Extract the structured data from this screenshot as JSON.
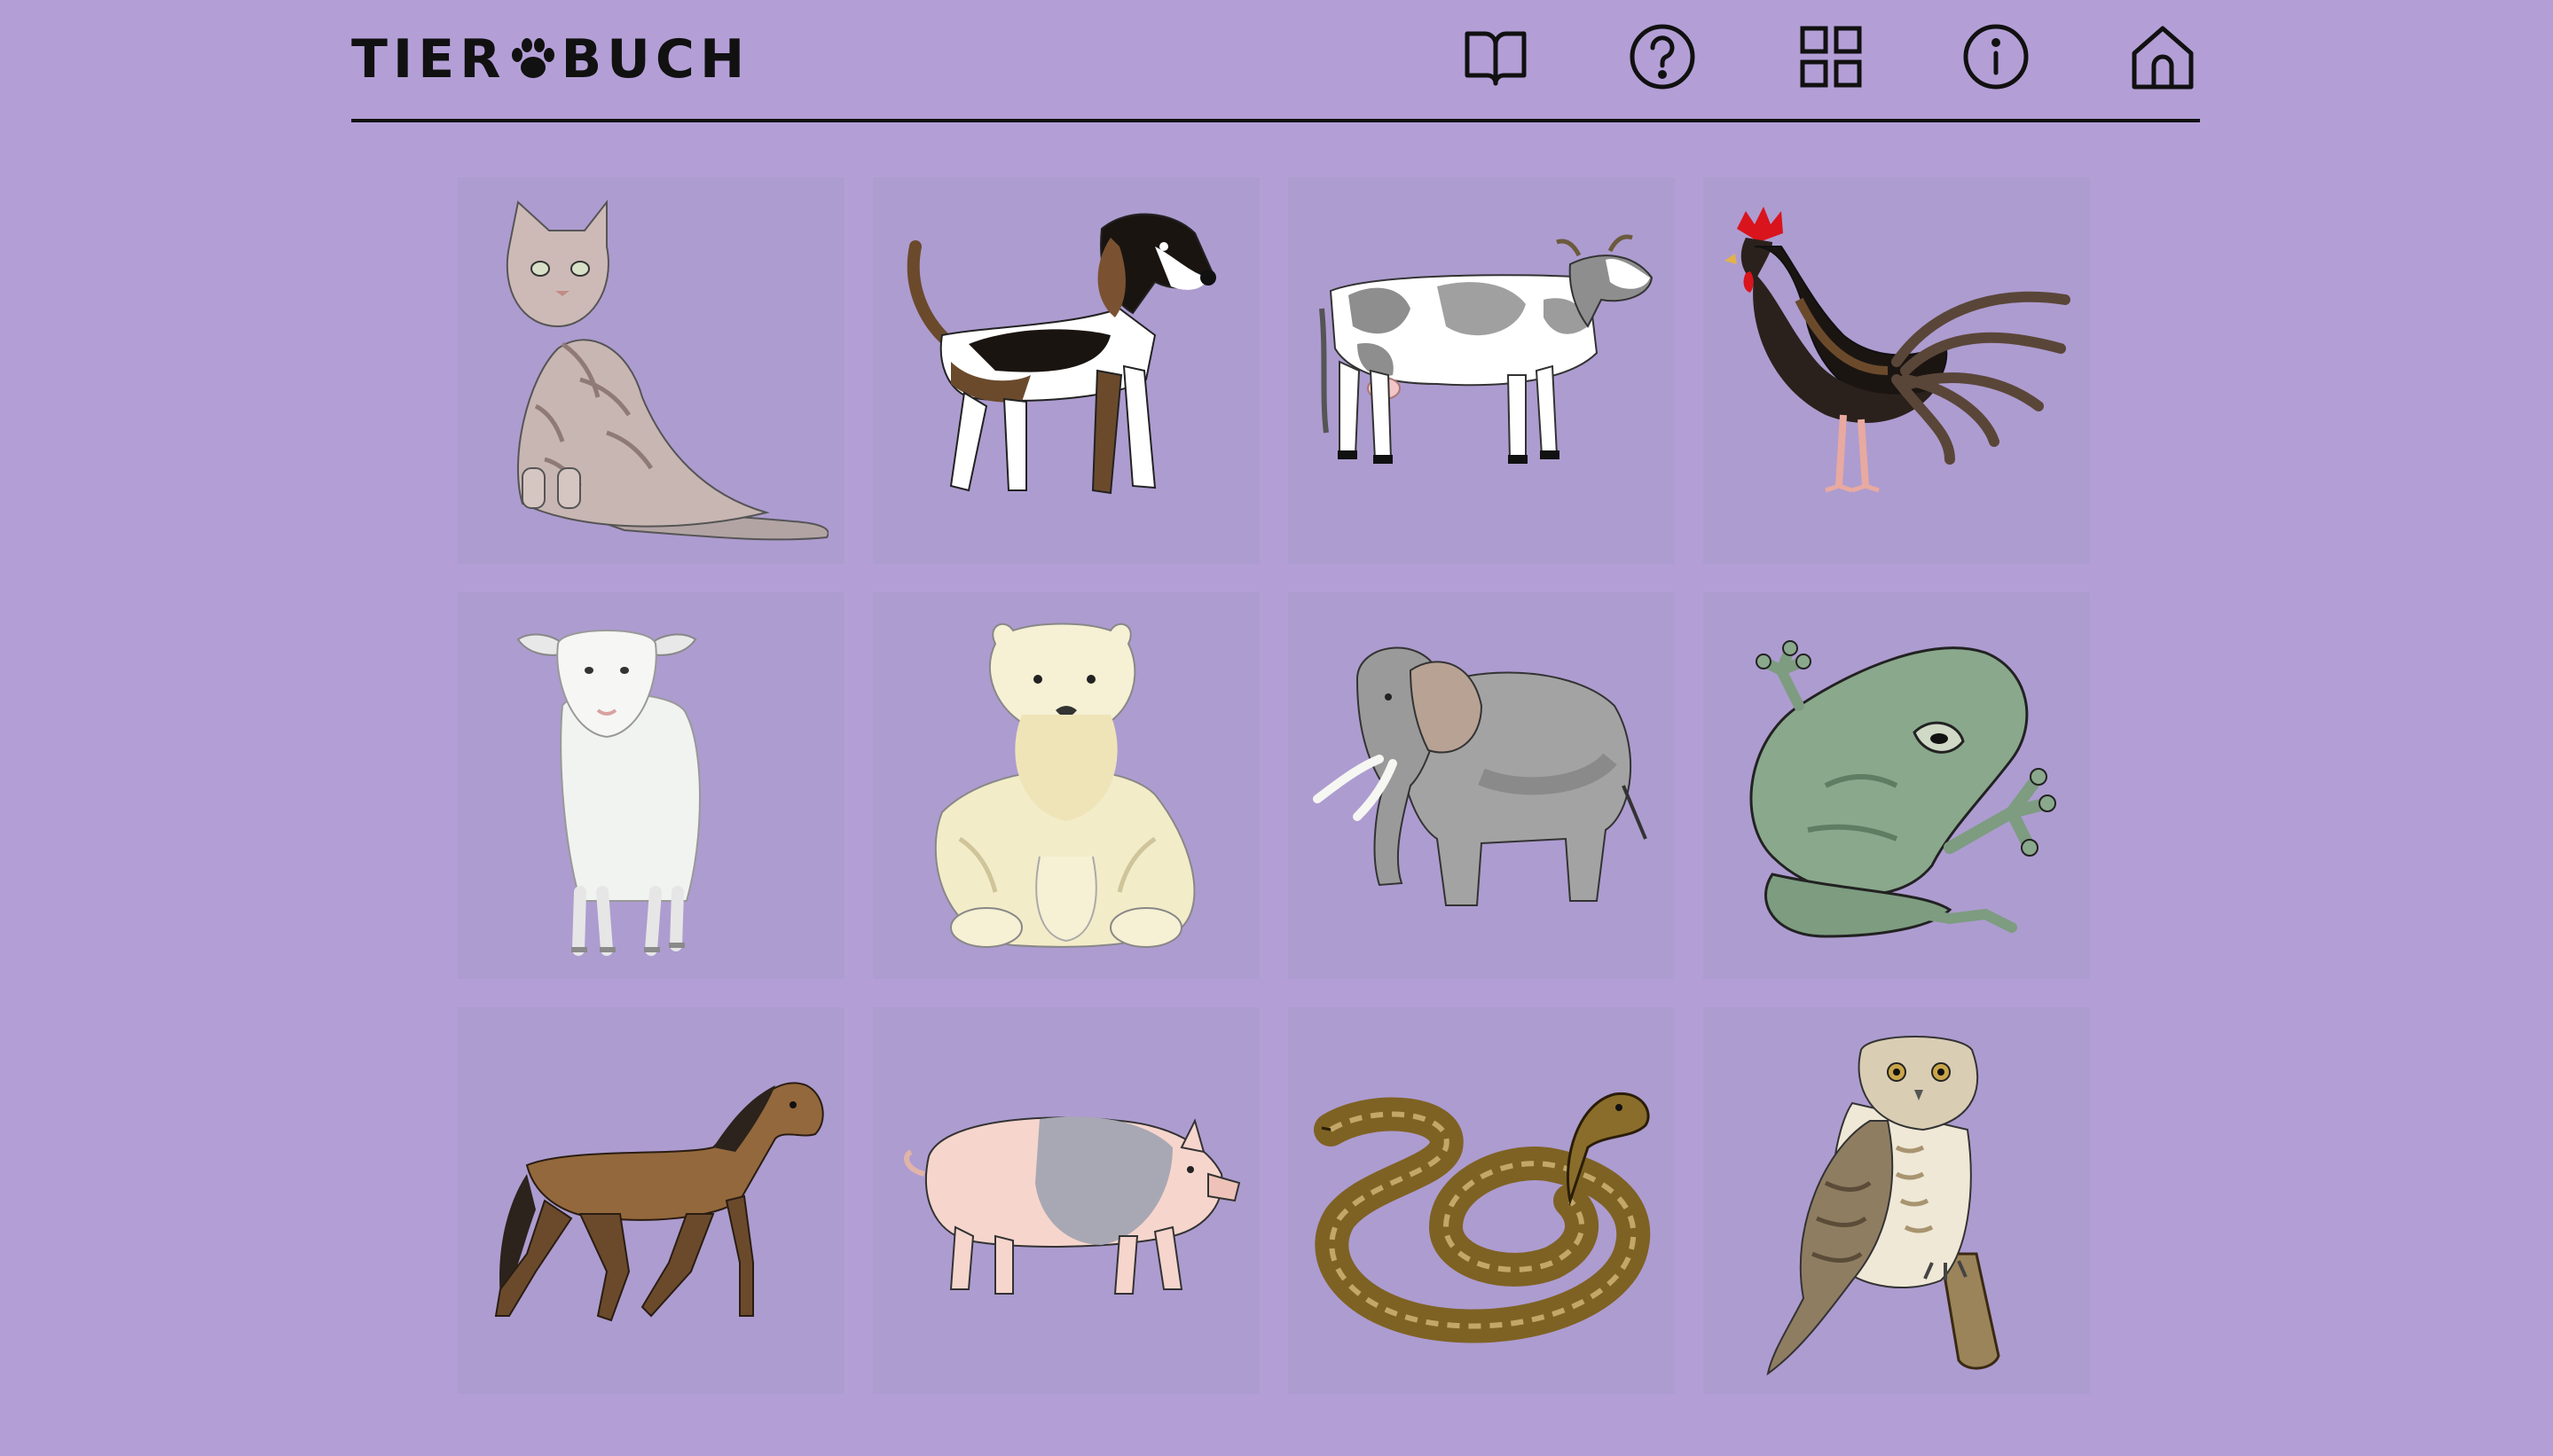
{
  "header": {
    "logo_left": "TIER",
    "logo_right": "BUCH",
    "nav": [
      {
        "icon": "book-open-icon"
      },
      {
        "icon": "help-circle-icon"
      },
      {
        "icon": "grid-icon"
      },
      {
        "icon": "info-icon"
      },
      {
        "icon": "home-icon"
      }
    ]
  },
  "colors": {
    "background": "#b39fd6",
    "tile": "#ad9cd0",
    "ink": "#111111"
  },
  "animals": [
    {
      "icon": "cat-icon"
    },
    {
      "icon": "dog-icon"
    },
    {
      "icon": "cow-icon"
    },
    {
      "icon": "rooster-icon"
    },
    {
      "icon": "sheep-icon"
    },
    {
      "icon": "polar-bear-icon"
    },
    {
      "icon": "elephant-icon"
    },
    {
      "icon": "frog-icon"
    },
    {
      "icon": "horse-icon"
    },
    {
      "icon": "pig-icon"
    },
    {
      "icon": "snake-icon"
    },
    {
      "icon": "owl-icon"
    }
  ]
}
